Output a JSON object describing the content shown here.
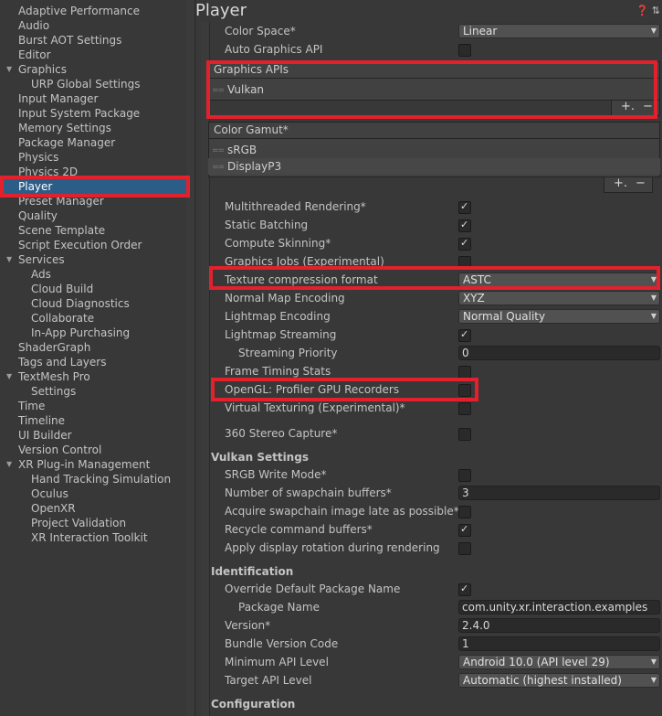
{
  "sidebar": {
    "items": [
      {
        "label": "Adaptive Performance",
        "indent": 0
      },
      {
        "label": "Audio",
        "indent": 0
      },
      {
        "label": "Burst AOT Settings",
        "indent": 0
      },
      {
        "label": "Editor",
        "indent": 0
      },
      {
        "label": "Graphics",
        "indent": 0,
        "arrow": "▼"
      },
      {
        "label": "URP Global Settings",
        "indent": 1
      },
      {
        "label": "Input Manager",
        "indent": 0
      },
      {
        "label": "Input System Package",
        "indent": 0
      },
      {
        "label": "Memory Settings",
        "indent": 0
      },
      {
        "label": "Package Manager",
        "indent": 0
      },
      {
        "label": "Physics",
        "indent": 0
      },
      {
        "label": "Physics 2D",
        "indent": 0
      },
      {
        "label": "Player",
        "indent": 0,
        "selected": true
      },
      {
        "label": "Preset Manager",
        "indent": 0
      },
      {
        "label": "Quality",
        "indent": 0
      },
      {
        "label": "Scene Template",
        "indent": 0
      },
      {
        "label": "Script Execution Order",
        "indent": 0
      },
      {
        "label": "Services",
        "indent": 0,
        "arrow": "▼"
      },
      {
        "label": "Ads",
        "indent": 1
      },
      {
        "label": "Cloud Build",
        "indent": 1
      },
      {
        "label": "Cloud Diagnostics",
        "indent": 1
      },
      {
        "label": "Collaborate",
        "indent": 1
      },
      {
        "label": "In-App Purchasing",
        "indent": 1
      },
      {
        "label": "ShaderGraph",
        "indent": 0
      },
      {
        "label": "Tags and Layers",
        "indent": 0
      },
      {
        "label": "TextMesh Pro",
        "indent": 0,
        "arrow": "▼"
      },
      {
        "label": "Settings",
        "indent": 1
      },
      {
        "label": "Time",
        "indent": 0
      },
      {
        "label": "Timeline",
        "indent": 0
      },
      {
        "label": "UI Builder",
        "indent": 0
      },
      {
        "label": "Version Control",
        "indent": 0
      },
      {
        "label": "XR Plug-in Management",
        "indent": 0,
        "arrow": "▼"
      },
      {
        "label": "Hand Tracking Simulation",
        "indent": 1
      },
      {
        "label": "Oculus",
        "indent": 1
      },
      {
        "label": "OpenXR",
        "indent": 1
      },
      {
        "label": "Project Validation",
        "indent": 1
      },
      {
        "label": "XR Interaction Toolkit",
        "indent": 1
      }
    ]
  },
  "main": {
    "title": "Player",
    "title_icons": "❓ ⇅",
    "color_space_label": "Color Space*",
    "color_space_value": "Linear",
    "auto_graphics_label": "Auto Graphics API",
    "graphics_apis_label": "Graphics APIs",
    "graphics_apis_items": [
      "Vulkan"
    ],
    "color_gamut_label": "Color Gamut*",
    "color_gamut_items": [
      "sRGB",
      "DisplayP3"
    ],
    "plus": "+.",
    "minus": "−",
    "list_handle": "==",
    "multithreaded_label": "Multithreaded Rendering*",
    "static_batching_label": "Static Batching",
    "compute_skinning_label": "Compute Skinning*",
    "graphics_jobs_label": "Graphics Jobs (Experimental)",
    "texture_compression_label": "Texture compression format",
    "texture_compression_value": "ASTC",
    "normal_map_label": "Normal Map Encoding",
    "normal_map_value": "XYZ",
    "lightmap_encoding_label": "Lightmap Encoding",
    "lightmap_encoding_value": "Normal Quality",
    "lightmap_streaming_label": "Lightmap Streaming",
    "streaming_priority_label": "Streaming Priority",
    "streaming_priority_value": "0",
    "frame_timing_label": "Frame Timing Stats",
    "opengl_profiler_label": "OpenGL: Profiler GPU Recorders",
    "virtual_texturing_label": "Virtual Texturing (Experimental)*",
    "stereo_capture_label": "360 Stereo Capture*",
    "vulkan_header": "Vulkan Settings",
    "srgb_write_label": "SRGB Write Mode*",
    "swapchain_buffers_label": "Number of swapchain buffers*",
    "swapchain_buffers_value": "3",
    "acquire_swapchain_label": "Acquire swapchain image late as possible*",
    "recycle_buffers_label": "Recycle command buffers*",
    "apply_rotation_label": "Apply display rotation during rendering",
    "identification_header": "Identification",
    "override_package_label": "Override Default Package Name",
    "package_name_label": "Package Name",
    "package_name_value": "com.unity.xr.interaction.examples",
    "version_label": "Version*",
    "version_value": "2.4.0",
    "bundle_code_label": "Bundle Version Code",
    "bundle_code_value": "1",
    "min_api_label": "Minimum API Level",
    "min_api_value": "Android 10.0 (API level 29)",
    "target_api_label": "Target API Level",
    "target_api_value": "Automatic (highest installed)",
    "configuration_header": "Configuration",
    "checkmark": "✓",
    "caret": "▼"
  },
  "colors": {
    "highlight": "#e3212d",
    "background": "#383838",
    "selected": "#2c5d87"
  }
}
